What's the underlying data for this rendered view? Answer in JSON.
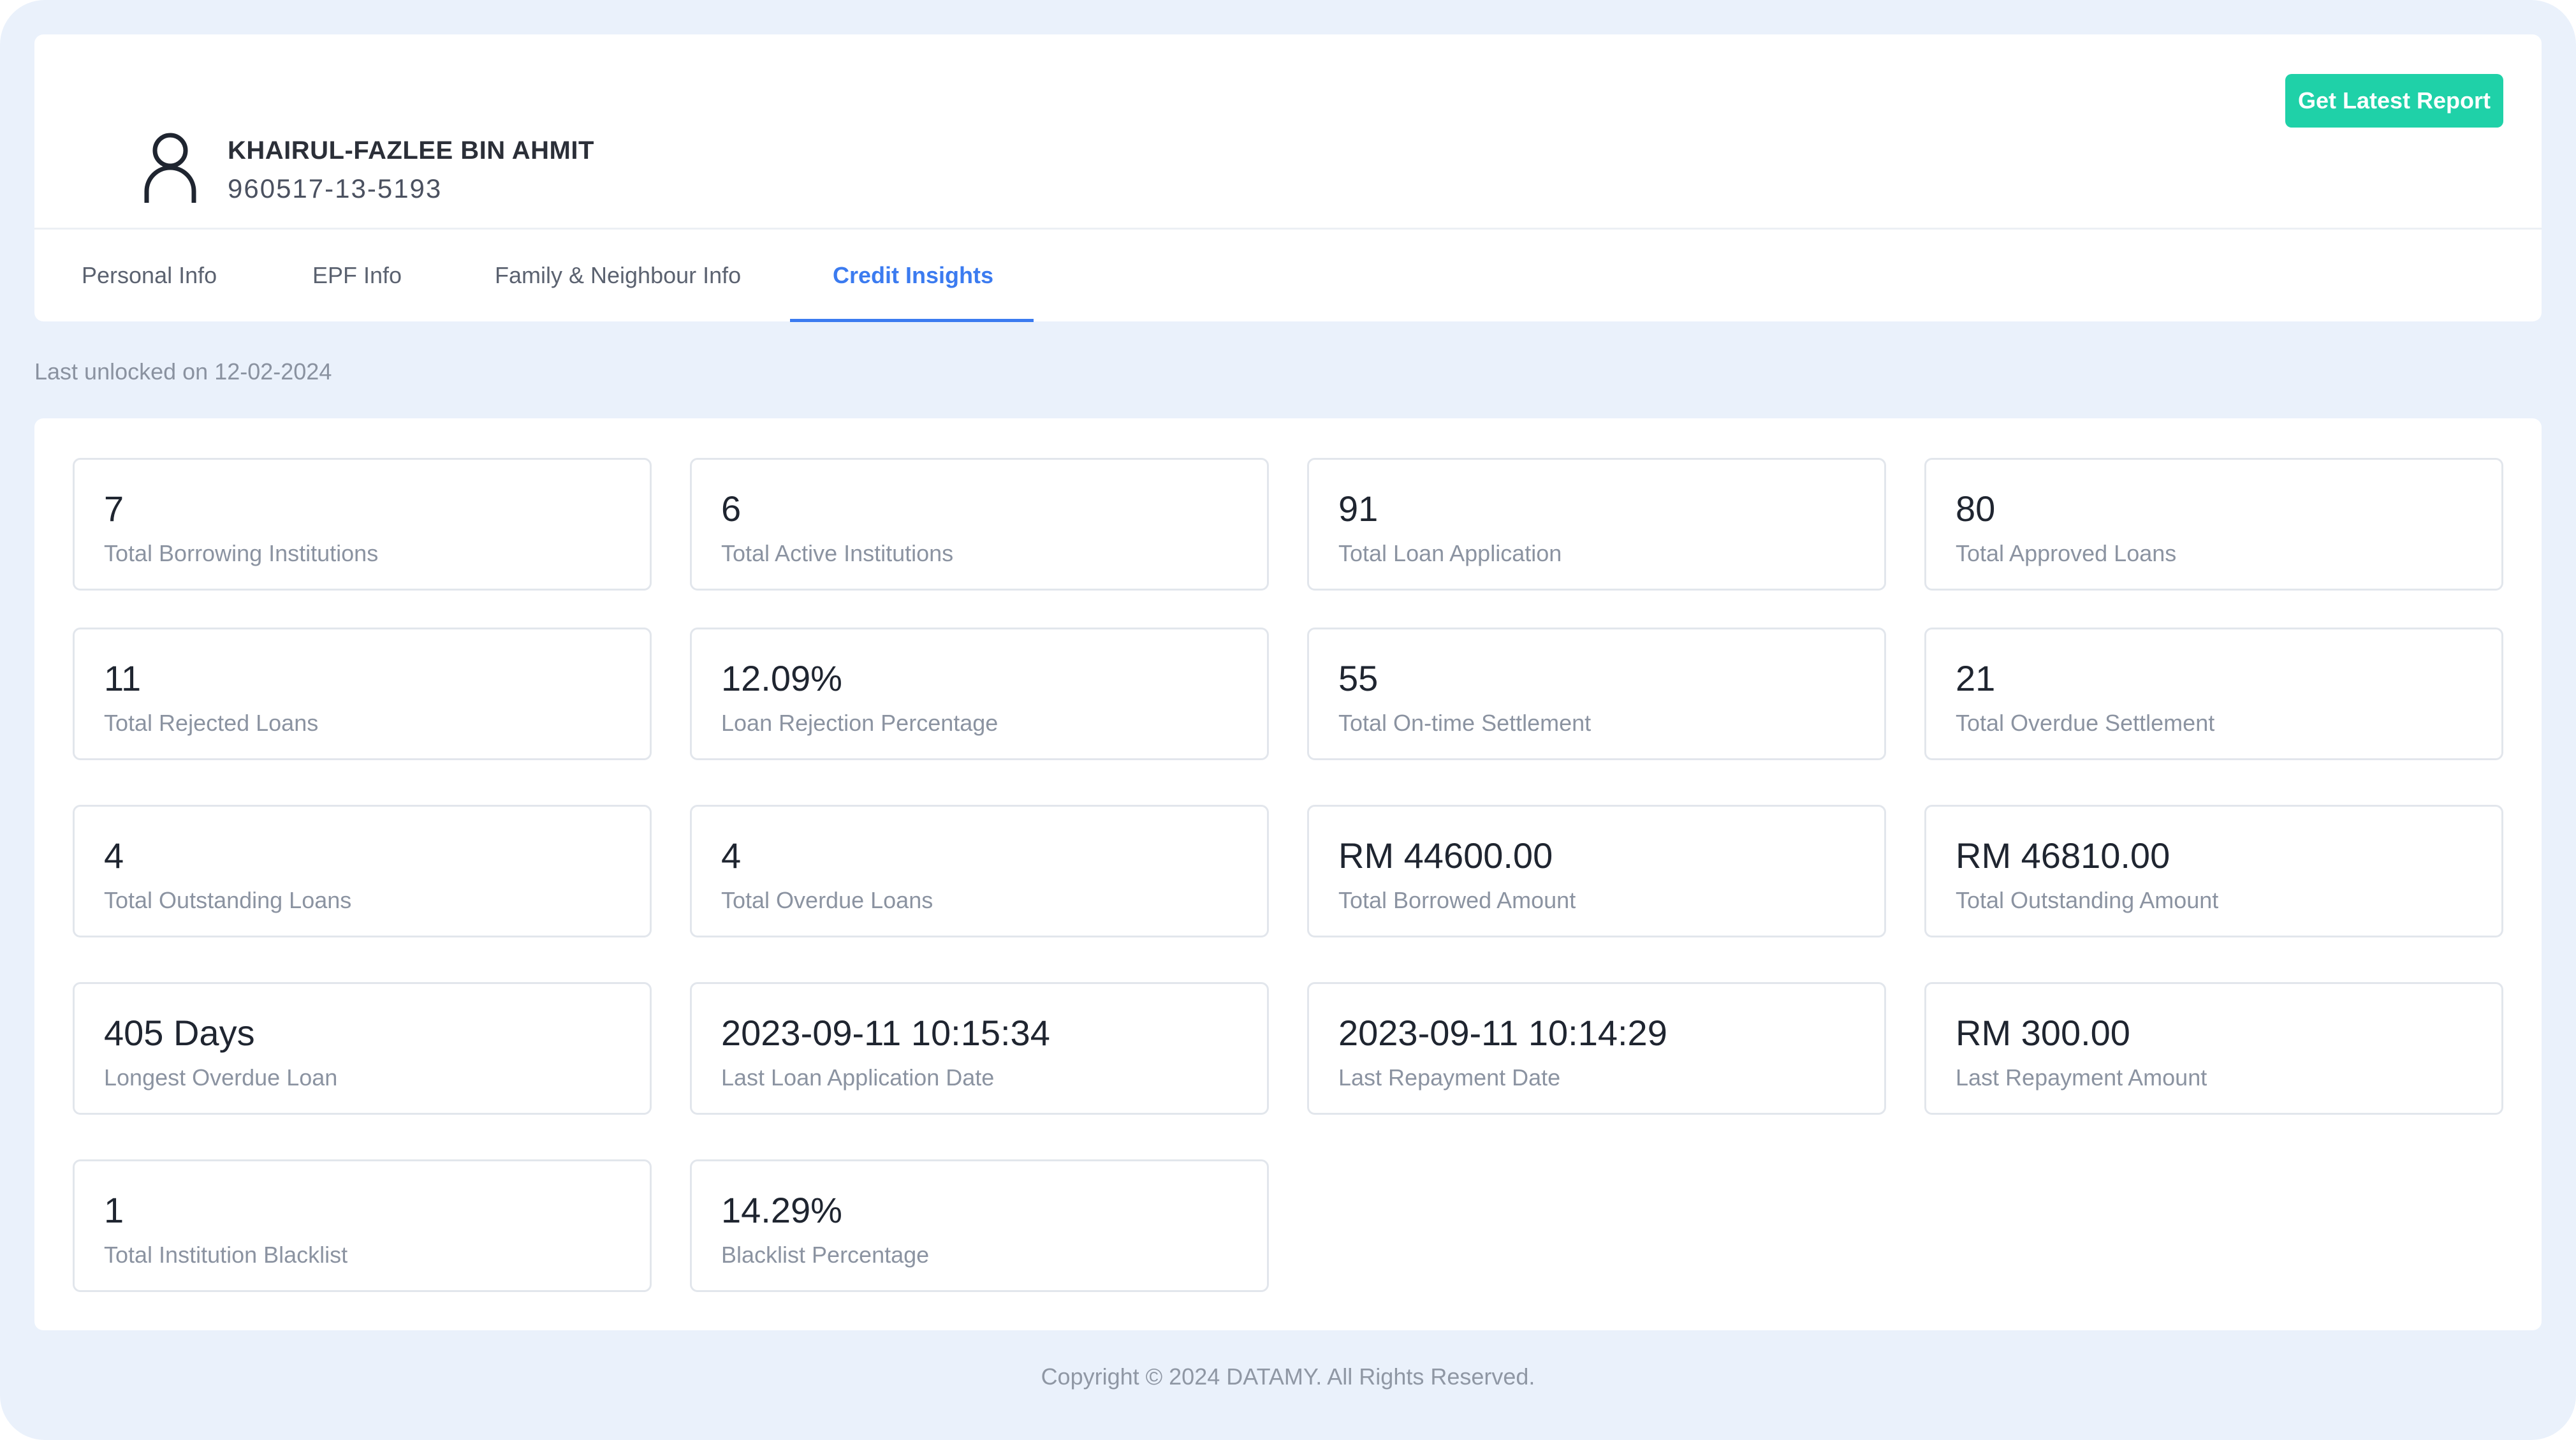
{
  "profile": {
    "name": "KHAIRUL-FAZLEE BIN AHMIT",
    "id_number": "960517-13-5193",
    "avatar_icon": "user-outline-icon"
  },
  "actions": {
    "get_report_label": "Get Latest Report",
    "accent_color": "#1fd1a8"
  },
  "tabs": [
    {
      "label": "Personal Info",
      "active": false
    },
    {
      "label": "EPF Info",
      "active": false
    },
    {
      "label": "Family & Neighbour Info",
      "active": false
    },
    {
      "label": "Credit Insights",
      "active": true
    }
  ],
  "last_unlocked": "Last unlocked on 12-02-2024",
  "stats": [
    {
      "value": "7",
      "label": "Total Borrowing Institutions"
    },
    {
      "value": "6",
      "label": "Total Active Institutions"
    },
    {
      "value": "91",
      "label": "Total Loan Application"
    },
    {
      "value": "80",
      "label": "Total Approved Loans"
    },
    {
      "value": "11",
      "label": "Total Rejected Loans"
    },
    {
      "value": "12.09%",
      "label": "Loan Rejection Percentage"
    },
    {
      "value": "55",
      "label": "Total On-time Settlement"
    },
    {
      "value": "21",
      "label": "Total Overdue Settlement"
    },
    {
      "value": "4",
      "label": "Total Outstanding Loans"
    },
    {
      "value": "4",
      "label": "Total Overdue Loans"
    },
    {
      "value": "RM 44600.00",
      "label": "Total Borrowed Amount"
    },
    {
      "value": "RM 46810.00",
      "label": "Total Outstanding Amount"
    },
    {
      "value": "405 Days",
      "label": "Longest Overdue Loan"
    },
    {
      "value": "2023-09-11 10:15:34",
      "label": "Last Loan Application Date"
    },
    {
      "value": "2023-09-11 10:14:29",
      "label": "Last Repayment Date"
    },
    {
      "value": "RM 300.00",
      "label": "Last Repayment Amount"
    },
    {
      "value": "1",
      "label": "Total Institution Blacklist"
    },
    {
      "value": "14.29%",
      "label": "Blacklist Percentage"
    }
  ],
  "footer": "Copyright © 2024 DATAMY. All Rights Reserved.",
  "colors": {
    "background": "#eaf1fb",
    "active_tab": "#3b7bf0"
  }
}
